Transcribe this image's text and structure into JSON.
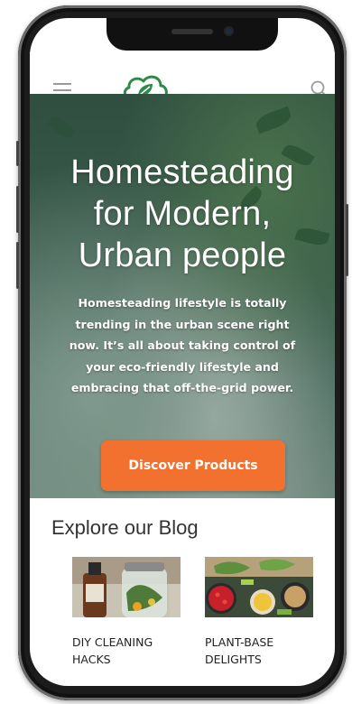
{
  "header": {
    "menu_icon": "hamburger-menu-icon",
    "logo_icon": "leaf-cloud-logo-icon",
    "search_icon": "search-icon"
  },
  "hero": {
    "title_lines": [
      "Homesteading",
      "for Modern,",
      "Urban people"
    ],
    "description_lines": [
      "Homesteading lifestyle is totally",
      "trending in the urban scene right",
      "now. It’s all about taking control of",
      "your eco-friendly lifestyle and",
      "embracing that off-the-grid power."
    ],
    "cta_label": "Discover Products"
  },
  "blog": {
    "title": "Explore our Blog",
    "cards": [
      {
        "caption_lines": [
          "DIY CLEANING",
          "HACKS"
        ]
      },
      {
        "caption_lines": [
          "PLANT-BASE",
          "DELIGHTS"
        ]
      }
    ]
  },
  "colors": {
    "accent": "#f2712e",
    "brand_green": "#2f8a4a"
  }
}
